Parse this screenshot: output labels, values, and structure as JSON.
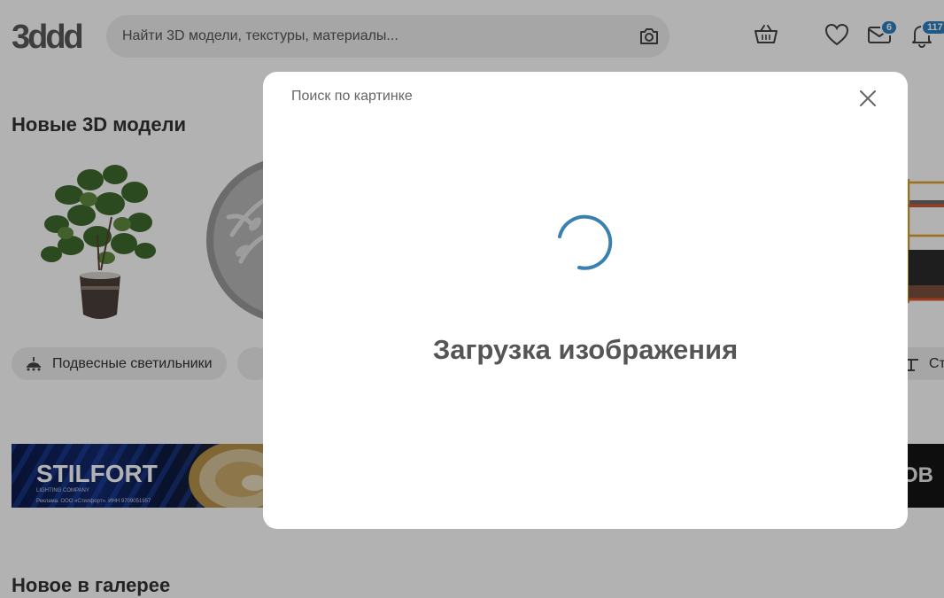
{
  "header": {
    "logo_text": "3ddd",
    "search": {
      "placeholder": "Найти 3D модели, текстуры, материалы..."
    },
    "icons": [
      "camera-icon",
      "basket-icon",
      "heart-icon",
      "mail-icon",
      "bell-icon"
    ],
    "mail_badge": "6",
    "notifications_badge": "117"
  },
  "sections": {
    "new_models_title": "Новые 3D модели",
    "gallery_title": "Новое в галерее"
  },
  "categories": [
    {
      "label": "Подвесные светильники",
      "icon": "pendant-lamp-icon"
    },
    {
      "label": "Сто",
      "icon": "table-icon"
    }
  ],
  "banners": {
    "left": {
      "brand": "STILFORT",
      "tagline": "LIGHTING COMPANY",
      "ad": "Реклама. ООО «Стилфорт». ИНН 9709051957"
    },
    "right": {
      "text": "OB"
    }
  },
  "modal": {
    "title": "Поиск по картинке",
    "loading_text": "Загрузка изображения"
  },
  "colors": {
    "accent": "#2f7fc1",
    "spinner": "#3a80b0",
    "overlay": "rgba(0,0,0,0.30)"
  }
}
